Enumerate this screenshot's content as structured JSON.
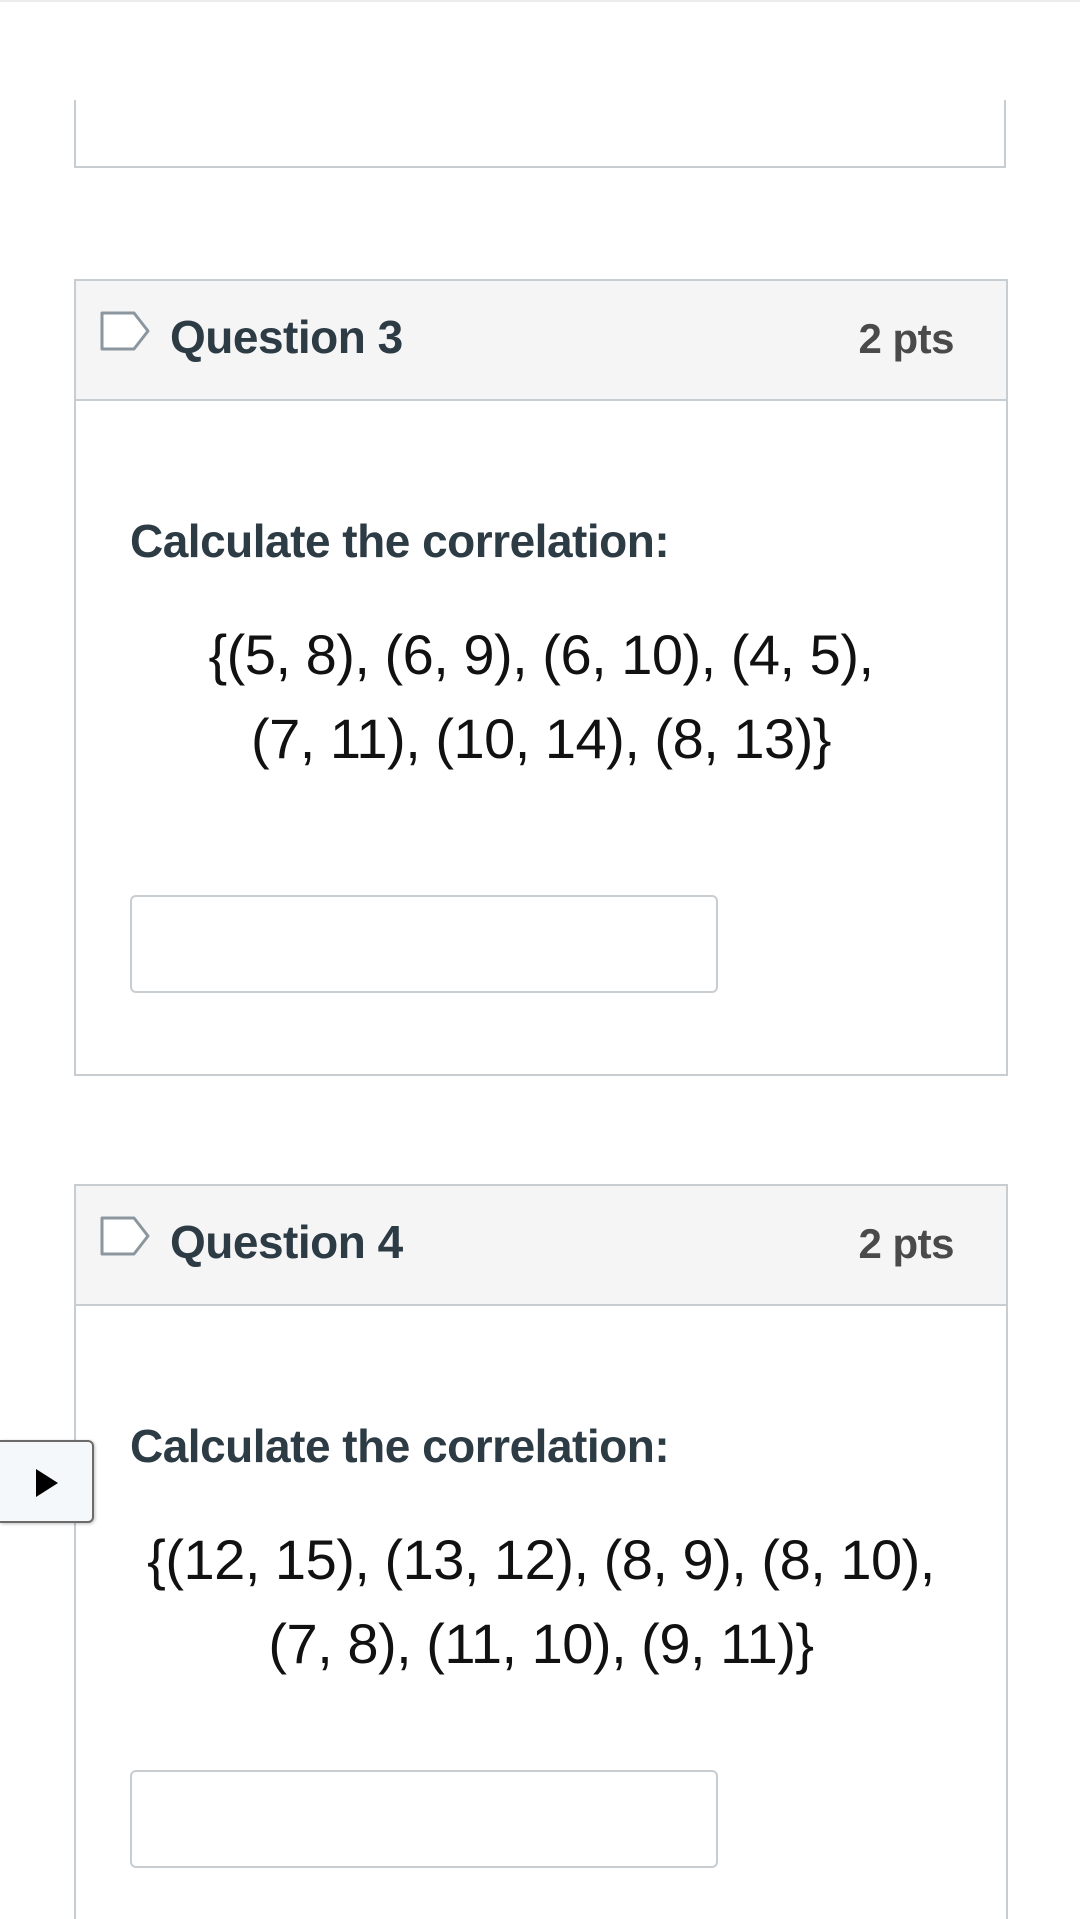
{
  "questions": [
    {
      "title": "Question 3",
      "points": "2 pts",
      "prompt": "Calculate the correlation:",
      "data_lines": [
        "{(5, 8), (6, 9), (6, 10), (4, 5),",
        "(7, 11), (10, 14), (8, 13)}"
      ],
      "answer_value": ""
    },
    {
      "title": "Question 4",
      "points": "2 pts",
      "prompt": "Calculate the correlation:",
      "data_lines": [
        "{(12, 15), (13, 12), (8, 9), (8, 10),",
        "(7, 8), (11, 10), (9, 11)}"
      ],
      "answer_value": ""
    }
  ],
  "icons": {
    "flag": "flag-outline-icon",
    "play": "play-icon"
  },
  "colors": {
    "border": "#c7cdd1",
    "header_bg": "#f5f5f5",
    "text": "#2d3b45"
  }
}
